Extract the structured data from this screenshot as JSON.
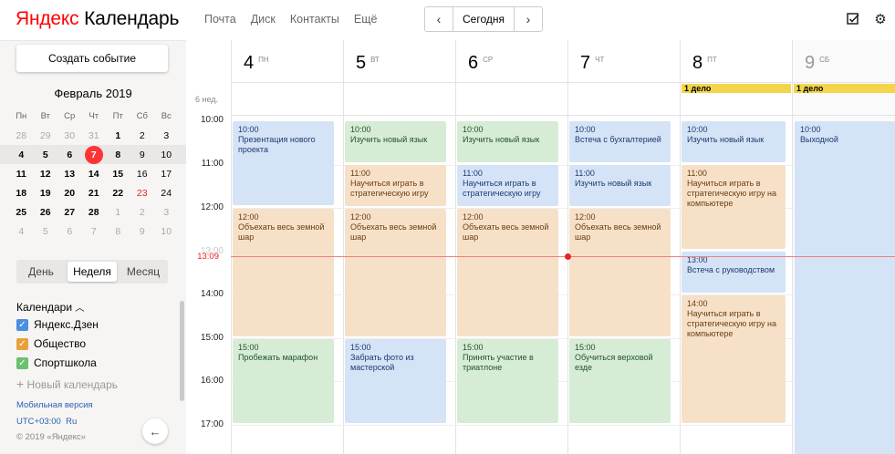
{
  "app": {
    "logo_yandex": "Яндекс",
    "logo_product": "Календарь"
  },
  "topnav": [
    "Почта",
    "Диск",
    "Контакты",
    "Ещё"
  ],
  "datenav": {
    "prev": "‹",
    "today": "Сегодня",
    "next": "›"
  },
  "header_icons": [
    "todo-check-icon",
    "gear-icon"
  ],
  "sidebar": {
    "create_button": "Создать событие",
    "month_title": "Февраль 2019",
    "weekdays": [
      "Пн",
      "Вт",
      "Ср",
      "Чт",
      "Пт",
      "Сб",
      "Вс"
    ],
    "weeks": [
      [
        "28",
        "29",
        "30",
        "31",
        "1",
        "2",
        "3"
      ],
      [
        "4",
        "5",
        "6",
        "7",
        "8",
        "9",
        "10"
      ],
      [
        "11",
        "12",
        "13",
        "14",
        "15",
        "16",
        "17"
      ],
      [
        "18",
        "19",
        "20",
        "21",
        "22",
        "23",
        "24"
      ],
      [
        "25",
        "26",
        "27",
        "28",
        "1",
        "2",
        "3"
      ],
      [
        "4",
        "5",
        "6",
        "7",
        "8",
        "9",
        "10"
      ]
    ],
    "view_switch": [
      "День",
      "Неделя",
      "Месяц"
    ],
    "view_selected": "Неделя",
    "calendars_header": "Календари",
    "calendars": [
      {
        "name": "Яндекс.Дзен",
        "color": "#4a8fe0"
      },
      {
        "name": "Общество",
        "color": "#e8a23c"
      },
      {
        "name": "Спортшкола",
        "color": "#6cc070"
      }
    ],
    "new_calendar": "Новый календарь",
    "mobile_link": "Мобильная версия",
    "timezone": "UTC+03:00",
    "language": "Ru",
    "copyright": "© 2019 «Яндекс»"
  },
  "week": {
    "week_label": "6 нед.",
    "hours": [
      "10:00",
      "11:00",
      "12:00",
      "13:00",
      "14:00",
      "15:00",
      "16:00",
      "17:00"
    ],
    "now_time": "13:09",
    "days": [
      {
        "num": "4",
        "wd": "ПН"
      },
      {
        "num": "5",
        "wd": "ВТ"
      },
      {
        "num": "6",
        "wd": "СР"
      },
      {
        "num": "7",
        "wd": "ЧТ"
      },
      {
        "num": "8",
        "wd": "ПТ"
      },
      {
        "num": "9",
        "wd": "СБ"
      }
    ],
    "allday": {
      "fri": "1 дело",
      "sat": "1 дело"
    },
    "events": {
      "mon": [
        {
          "time": "10:00",
          "title": "Презентация нового проекта"
        },
        {
          "time": "12:00",
          "title": "Объехать весь земной шар"
        },
        {
          "time": "15:00",
          "title": "Пробежать марафон"
        }
      ],
      "tue": [
        {
          "time": "10:00",
          "title": "Изучить новый язык"
        },
        {
          "time": "11:00",
          "title": "Научиться играть в стратегическую игру"
        },
        {
          "time": "12:00",
          "title": "Объехать весь земной шар"
        },
        {
          "time": "15:00",
          "title": "Забрать фото из мастерской"
        }
      ],
      "wed": [
        {
          "time": "10:00",
          "title": "Изучить новый язык"
        },
        {
          "time": "11:00",
          "title": "Научиться играть в стратегическую игру"
        },
        {
          "time": "12:00",
          "title": "Объехать весь земной шар"
        },
        {
          "time": "15:00",
          "title": "Принять участие в триатлоне"
        }
      ],
      "thu": [
        {
          "time": "10:00",
          "title": "Встеча с бухгалтерией"
        },
        {
          "time": "11:00",
          "title": "Изучить новый язык"
        },
        {
          "time": "12:00",
          "title": "Объехать весь земной шар"
        },
        {
          "time": "15:00",
          "title": "Обучиться верховой езде"
        }
      ],
      "fri": [
        {
          "time": "10:00",
          "title": "Изучить новый язык"
        },
        {
          "time": "11:00",
          "title": "Научиться играть в стратегическую игру на компьютере"
        },
        {
          "time": "13:00",
          "title": "Встеча с руководством"
        },
        {
          "time": "14:00",
          "title": "Научиться играть в стратегическую игру на компьютере"
        }
      ],
      "sat": [
        {
          "time": "10:00",
          "title": "Выходной"
        }
      ]
    }
  }
}
